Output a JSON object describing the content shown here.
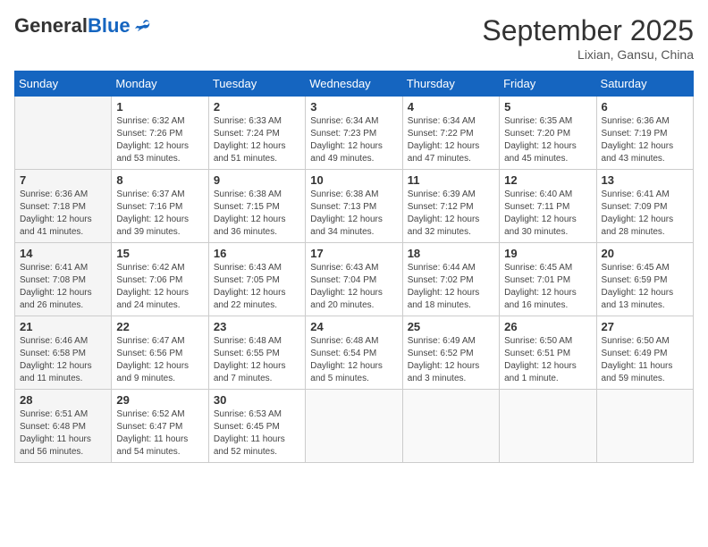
{
  "header": {
    "logo_general": "General",
    "logo_blue": "Blue",
    "month_title": "September 2025",
    "location": "Lixian, Gansu, China"
  },
  "weekdays": [
    "Sunday",
    "Monday",
    "Tuesday",
    "Wednesday",
    "Thursday",
    "Friday",
    "Saturday"
  ],
  "weeks": [
    [
      {
        "day": "",
        "info": ""
      },
      {
        "day": "1",
        "info": "Sunrise: 6:32 AM\nSunset: 7:26 PM\nDaylight: 12 hours\nand 53 minutes."
      },
      {
        "day": "2",
        "info": "Sunrise: 6:33 AM\nSunset: 7:24 PM\nDaylight: 12 hours\nand 51 minutes."
      },
      {
        "day": "3",
        "info": "Sunrise: 6:34 AM\nSunset: 7:23 PM\nDaylight: 12 hours\nand 49 minutes."
      },
      {
        "day": "4",
        "info": "Sunrise: 6:34 AM\nSunset: 7:22 PM\nDaylight: 12 hours\nand 47 minutes."
      },
      {
        "day": "5",
        "info": "Sunrise: 6:35 AM\nSunset: 7:20 PM\nDaylight: 12 hours\nand 45 minutes."
      },
      {
        "day": "6",
        "info": "Sunrise: 6:36 AM\nSunset: 7:19 PM\nDaylight: 12 hours\nand 43 minutes."
      }
    ],
    [
      {
        "day": "7",
        "info": "Sunrise: 6:36 AM\nSunset: 7:18 PM\nDaylight: 12 hours\nand 41 minutes."
      },
      {
        "day": "8",
        "info": "Sunrise: 6:37 AM\nSunset: 7:16 PM\nDaylight: 12 hours\nand 39 minutes."
      },
      {
        "day": "9",
        "info": "Sunrise: 6:38 AM\nSunset: 7:15 PM\nDaylight: 12 hours\nand 36 minutes."
      },
      {
        "day": "10",
        "info": "Sunrise: 6:38 AM\nSunset: 7:13 PM\nDaylight: 12 hours\nand 34 minutes."
      },
      {
        "day": "11",
        "info": "Sunrise: 6:39 AM\nSunset: 7:12 PM\nDaylight: 12 hours\nand 32 minutes."
      },
      {
        "day": "12",
        "info": "Sunrise: 6:40 AM\nSunset: 7:11 PM\nDaylight: 12 hours\nand 30 minutes."
      },
      {
        "day": "13",
        "info": "Sunrise: 6:41 AM\nSunset: 7:09 PM\nDaylight: 12 hours\nand 28 minutes."
      }
    ],
    [
      {
        "day": "14",
        "info": "Sunrise: 6:41 AM\nSunset: 7:08 PM\nDaylight: 12 hours\nand 26 minutes."
      },
      {
        "day": "15",
        "info": "Sunrise: 6:42 AM\nSunset: 7:06 PM\nDaylight: 12 hours\nand 24 minutes."
      },
      {
        "day": "16",
        "info": "Sunrise: 6:43 AM\nSunset: 7:05 PM\nDaylight: 12 hours\nand 22 minutes."
      },
      {
        "day": "17",
        "info": "Sunrise: 6:43 AM\nSunset: 7:04 PM\nDaylight: 12 hours\nand 20 minutes."
      },
      {
        "day": "18",
        "info": "Sunrise: 6:44 AM\nSunset: 7:02 PM\nDaylight: 12 hours\nand 18 minutes."
      },
      {
        "day": "19",
        "info": "Sunrise: 6:45 AM\nSunset: 7:01 PM\nDaylight: 12 hours\nand 16 minutes."
      },
      {
        "day": "20",
        "info": "Sunrise: 6:45 AM\nSunset: 6:59 PM\nDaylight: 12 hours\nand 13 minutes."
      }
    ],
    [
      {
        "day": "21",
        "info": "Sunrise: 6:46 AM\nSunset: 6:58 PM\nDaylight: 12 hours\nand 11 minutes."
      },
      {
        "day": "22",
        "info": "Sunrise: 6:47 AM\nSunset: 6:56 PM\nDaylight: 12 hours\nand 9 minutes."
      },
      {
        "day": "23",
        "info": "Sunrise: 6:48 AM\nSunset: 6:55 PM\nDaylight: 12 hours\nand 7 minutes."
      },
      {
        "day": "24",
        "info": "Sunrise: 6:48 AM\nSunset: 6:54 PM\nDaylight: 12 hours\nand 5 minutes."
      },
      {
        "day": "25",
        "info": "Sunrise: 6:49 AM\nSunset: 6:52 PM\nDaylight: 12 hours\nand 3 minutes."
      },
      {
        "day": "26",
        "info": "Sunrise: 6:50 AM\nSunset: 6:51 PM\nDaylight: 12 hours\nand 1 minute."
      },
      {
        "day": "27",
        "info": "Sunrise: 6:50 AM\nSunset: 6:49 PM\nDaylight: 11 hours\nand 59 minutes."
      }
    ],
    [
      {
        "day": "28",
        "info": "Sunrise: 6:51 AM\nSunset: 6:48 PM\nDaylight: 11 hours\nand 56 minutes."
      },
      {
        "day": "29",
        "info": "Sunrise: 6:52 AM\nSunset: 6:47 PM\nDaylight: 11 hours\nand 54 minutes."
      },
      {
        "day": "30",
        "info": "Sunrise: 6:53 AM\nSunset: 6:45 PM\nDaylight: 11 hours\nand 52 minutes."
      },
      {
        "day": "",
        "info": ""
      },
      {
        "day": "",
        "info": ""
      },
      {
        "day": "",
        "info": ""
      },
      {
        "day": "",
        "info": ""
      }
    ]
  ]
}
